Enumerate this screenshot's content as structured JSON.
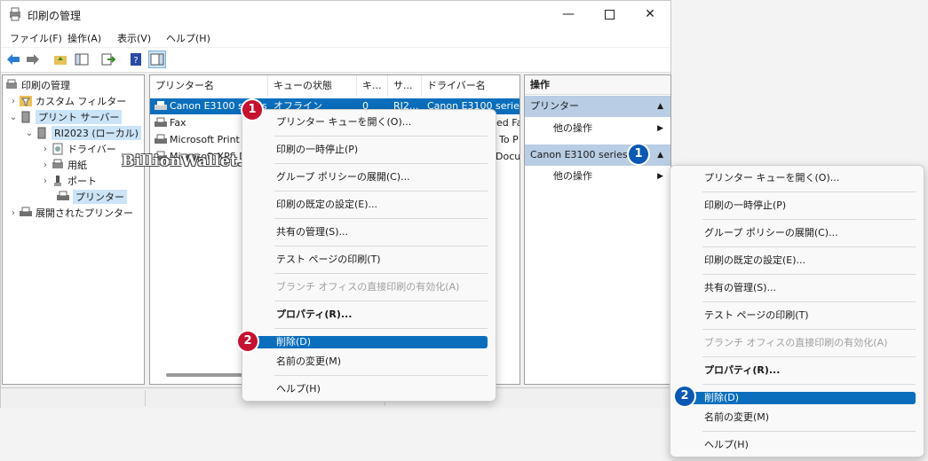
{
  "window": {
    "title": "印刷の管理"
  },
  "menu": [
    "ファイル(F)",
    "操作(A)",
    "表示(V)",
    "ヘルプ(H)"
  ],
  "tree": {
    "root": "印刷の管理",
    "custom_filters": "カスタム フィルター",
    "print_servers": "プリント サーバー",
    "server": "RI2023 (ローカル)",
    "drivers": "ドライバー",
    "forms": "用紙",
    "ports": "ポート",
    "printers": "プリンター",
    "deployed": "展開されたプリンター"
  },
  "list": {
    "columns": [
      "プリンター名",
      "キューの状態",
      "キ...",
      "サ...",
      "ドライバー名"
    ],
    "rows": [
      {
        "name": "Canon E3100 series",
        "status": "オフライン",
        "jobs": "0",
        "server": "RI2...",
        "driver": "Canon E3100 series"
      },
      {
        "name": "Fax",
        "status": "",
        "jobs": "",
        "server": "",
        "driver": "ed Fa"
      },
      {
        "name": "Microsoft Print",
        "status": "",
        "jobs": "",
        "server": "",
        "driver": "To P"
      },
      {
        "name": "Microsoft XPS D",
        "status": "",
        "jobs": "",
        "server": "",
        "driver": "Docu"
      }
    ]
  },
  "actions": {
    "header": "操作",
    "section1": "プリンター",
    "more1": "他の操作",
    "section2": "Canon E3100 series",
    "more2": "他の操作"
  },
  "context_menu": {
    "items": [
      "プリンター キューを開く(O)...",
      "印刷の一時停止(P)",
      "グループ ポリシーの展開(C)...",
      "印刷の既定の設定(E)...",
      "共有の管理(S)...",
      "テスト ページの印刷(T)",
      "ブランチ オフィスの直接印刷の有効化(A)",
      "プロパティ(R)...",
      "削除(D)",
      "名前の変更(M)",
      "ヘルプ(H)"
    ]
  },
  "badges": {
    "one": "1",
    "two": "2"
  },
  "watermark": "BillionWallet.com",
  "colors": {
    "highlight": "#0a6ebd",
    "badge": "#c4122f",
    "badge_blue": "#0a58b4",
    "action_section": "#b9cde4"
  }
}
